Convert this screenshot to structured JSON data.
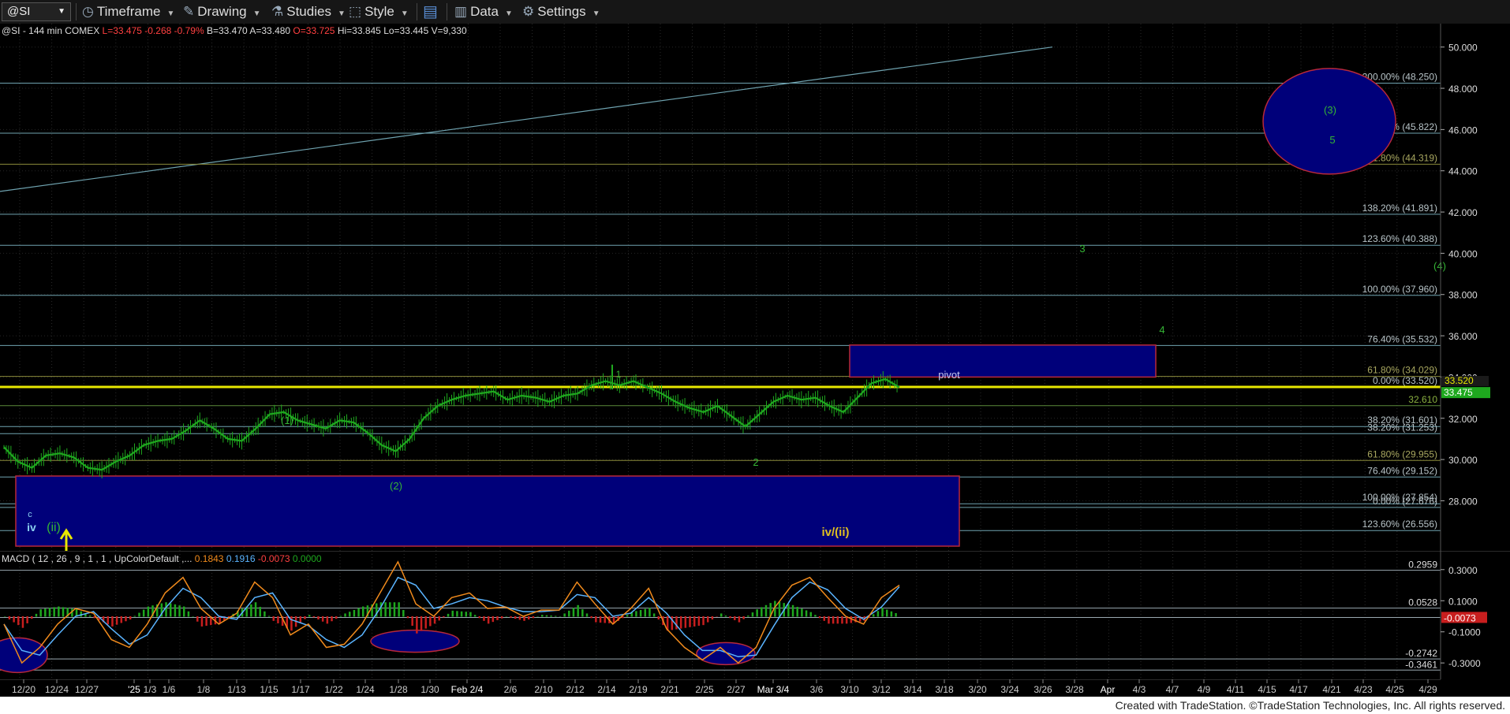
{
  "toolbar": {
    "symbol": "@SI",
    "timeframe": "Timeframe",
    "drawing": "Drawing",
    "studies": "Studies",
    "style": "Style",
    "data": "Data",
    "settings": "Settings"
  },
  "chart_header": {
    "prefix": "@SI - 144 min  COMEX",
    "last": "L=33.475",
    "change": "-0.268",
    "change_pct": "-0.79%",
    "bid_ask": "B=33.470  A=33.480",
    "open": "O=33.725",
    "rest": "Hi=33.845  Lo=33.445  V=9,330"
  },
  "macd_header": {
    "label": "MACD ( 12 , 26 , 9 , 1 , 1 , UpColorDefault ,...",
    "v1": "0.1843",
    "v2": "0.1916",
    "v3": "-0.0073",
    "v4": "0.0000"
  },
  "footer": "Created with TradeStation. ©TradeStation Technologies, Inc. All rights reserved.",
  "colors": {
    "price_bars": "#1fa91f",
    "fib_line": "#6fa3b0",
    "yellow_line": "#e8e800",
    "zone_fill": "#00007a",
    "zone_border": "#b8283a",
    "macd_fast": "#f08a1c",
    "macd_slow": "#5ab4ff",
    "hist_pos": "#1ea81e",
    "hist_neg": "#c81e1e"
  },
  "chart_data": [
    {
      "type": "line",
      "title": "@SI - 144 min",
      "ylim": [
        25.8,
        50.6
      ],
      "y_ticks": [
        "50.000",
        "48.000",
        "46.000",
        "44.000",
        "42.000",
        "40.000",
        "38.000",
        "36.000",
        "34.000",
        "32.000",
        "30.000",
        "28.000"
      ],
      "x_tick_labels": [
        "12/20",
        "12/24",
        "12/27",
        "'25",
        "1/3",
        "1/6",
        "1/8",
        "1/13",
        "1/15",
        "1/17",
        "1/22",
        "1/24",
        "1/28",
        "1/30",
        "Feb 2/4",
        "2/6",
        "2/10",
        "2/12",
        "2/14",
        "2/19",
        "2/21",
        "2/25",
        "2/27",
        "Mar 3/4",
        "3/6",
        "3/10",
        "3/12",
        "3/14",
        "3/18",
        "3/20",
        "3/24",
        "3/26",
        "3/28",
        "Apr",
        "4/3",
        "4/7",
        "4/9",
        "4/11",
        "4/15",
        "4/17",
        "4/21",
        "4/23",
        "4/25",
        "4/29"
      ],
      "series": [
        {
          "name": "@SI",
          "y": [
            30.6,
            29.9,
            29.6,
            30.2,
            30.3,
            30.1,
            29.6,
            29.5,
            29.9,
            30.2,
            30.7,
            30.9,
            31.0,
            31.4,
            31.9,
            31.5,
            31.0,
            30.9,
            31.5,
            32.2,
            32.3,
            31.9,
            31.7,
            31.5,
            31.9,
            31.8,
            31.3,
            30.7,
            30.4,
            31.0,
            32.0,
            32.6,
            32.9,
            33.1,
            33.2,
            33.3,
            32.9,
            33.1,
            33.0,
            32.8,
            33.1,
            33.2,
            33.6,
            33.8,
            33.6,
            33.8,
            33.5,
            33.2,
            32.8,
            32.5,
            32.3,
            32.6,
            32.1,
            31.6,
            32.2,
            32.8,
            33.1,
            32.9,
            33.0,
            32.6,
            32.3,
            33.0,
            33.7,
            33.9,
            33.5
          ]
        }
      ],
      "horizontal_levels": [
        {
          "label": "200.00% (48.250)",
          "value": 48.25
        },
        {
          "label": "176.40% (45.822)",
          "value": 45.822
        },
        {
          "label": "161.80% (44.319)",
          "value": 44.319
        },
        {
          "label": "138.20% (41.891)",
          "value": 41.891
        },
        {
          "label": "123.60% (40.388)",
          "value": 40.388
        },
        {
          "label": "100.00% (37.960)",
          "value": 37.96
        },
        {
          "label": "76.40% (35.532)",
          "value": 35.532
        },
        {
          "label": "61.80% (34.029)",
          "value": 34.029
        },
        {
          "label": "0.00% (33.520)",
          "value": 33.52
        },
        {
          "label": "32.610",
          "value": 32.61
        },
        {
          "label": "38.20% (31.601)",
          "value": 31.601
        },
        {
          "label": "38.20% (31.253)",
          "value": 31.253
        },
        {
          "label": "61.80% (29.955)",
          "value": 29.955
        },
        {
          "label": "76.40% (29.152)",
          "value": 29.152
        },
        {
          "label": "100.00% (27.854)",
          "value": 27.854
        },
        {
          "label": "0.00% (27.676)",
          "value": 27.676
        },
        {
          "label": "123.60% (26.556)",
          "value": 26.556
        }
      ],
      "price_marker": "33.475",
      "level_marker": "33.520",
      "annotations": [
        "1",
        "(1)",
        "(2)",
        "2",
        "3",
        "4",
        "(3)",
        "5",
        "(4)",
        "pivot",
        "c",
        "iv",
        "(ii)",
        "iv/(ii)"
      ]
    },
    {
      "type": "line",
      "title": "MACD ( 12 , 26 , 9 , 1 , 1 , UpColorDefault ,...",
      "ylim": [
        -0.38,
        0.38
      ],
      "y_ticks": [
        "0.3000",
        "0.1000",
        "-0.1000",
        "-0.3000"
      ],
      "levels": [
        {
          "label": "0.2959",
          "value": 0.2959
        },
        {
          "label": "0.0528",
          "value": 0.0528
        },
        {
          "label": "-0.0073",
          "value": -0.0073
        },
        {
          "label": "-0.2742",
          "value": -0.2742
        },
        {
          "label": "-0.3461",
          "value": -0.3461
        }
      ],
      "series": [
        {
          "name": "MACD",
          "y": [
            -0.05,
            -0.3,
            -0.2,
            -0.05,
            0.05,
            0.02,
            -0.15,
            -0.2,
            -0.05,
            0.15,
            0.25,
            0.05,
            -0.05,
            0.02,
            0.22,
            0.12,
            -0.12,
            -0.05,
            -0.2,
            -0.18,
            -0.05,
            0.15,
            0.35,
            0.08,
            0.0,
            0.12,
            0.15,
            0.05,
            0.06,
            0.0,
            0.04,
            0.04,
            0.22,
            0.08,
            -0.05,
            0.05,
            0.18,
            -0.08,
            -0.2,
            -0.28,
            -0.2,
            -0.3,
            -0.2,
            0.05,
            0.2,
            0.25,
            0.12,
            0.0,
            -0.05,
            0.12,
            0.2
          ]
        },
        {
          "name": "Avg",
          "y": [
            -0.05,
            -0.22,
            -0.25,
            -0.12,
            0.0,
            0.03,
            -0.08,
            -0.18,
            -0.12,
            0.05,
            0.18,
            0.12,
            0.0,
            -0.02,
            0.12,
            0.15,
            -0.02,
            -0.06,
            -0.15,
            -0.2,
            -0.12,
            0.05,
            0.25,
            0.2,
            0.05,
            0.08,
            0.12,
            0.1,
            0.06,
            0.03,
            0.03,
            0.04,
            0.14,
            0.12,
            0.0,
            0.02,
            0.12,
            0.02,
            -0.12,
            -0.22,
            -0.22,
            -0.26,
            -0.25,
            -0.06,
            0.12,
            0.22,
            0.17,
            0.05,
            -0.02,
            0.06,
            0.19
          ]
        }
      ]
    }
  ]
}
